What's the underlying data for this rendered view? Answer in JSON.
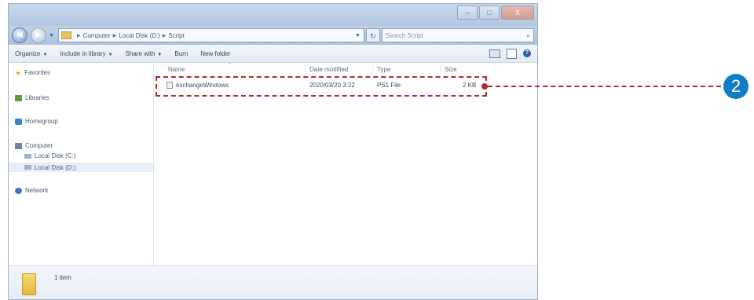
{
  "window": {
    "controls": {
      "minimize": "–",
      "maximize": "□",
      "close": "X"
    }
  },
  "address": {
    "crumbs": [
      "Computer",
      "Local Disk (D:)",
      "Script"
    ],
    "search_placeholder": "Search Script"
  },
  "toolbar": {
    "organize": "Organize",
    "include_in_library": "Include in library",
    "share_with": "Share with",
    "burn": "Burn",
    "new_folder": "New folder"
  },
  "nav": {
    "favorites": "Favorites",
    "libraries": "Libraries",
    "homegroup": "Homegroup",
    "computer": "Computer",
    "drive_c": "Local Disk (C:)",
    "drive_d": "Local Disk (D:)",
    "network": "Network"
  },
  "columns": {
    "name": "Name",
    "date_modified": "Date modified",
    "type": "Type",
    "size": "Size"
  },
  "files": [
    {
      "name": "exchangeWindows",
      "date": "2020/03/20 3:22",
      "type": "PS1 File",
      "size": "2 KB"
    }
  ],
  "details": {
    "label": "1 item"
  },
  "annotation": {
    "step": "2",
    "color": "#b3282d",
    "badge_color": "#0f7ec6"
  }
}
